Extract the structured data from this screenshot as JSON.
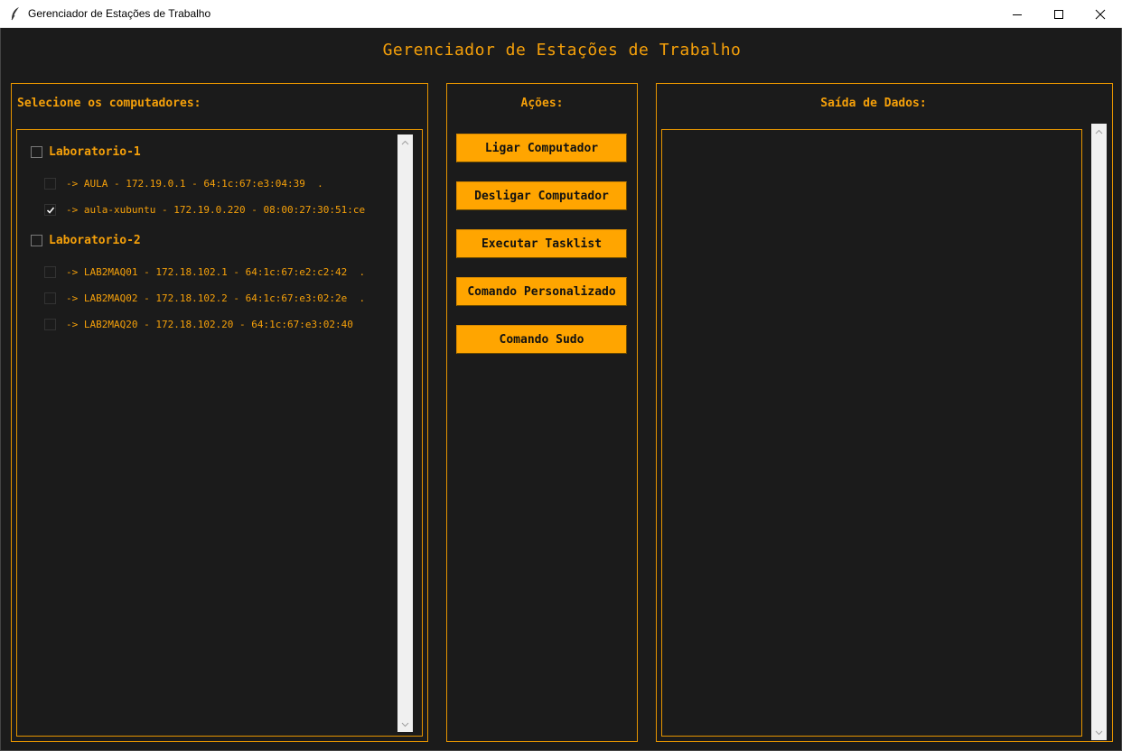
{
  "window": {
    "title": "Gerenciador de Estações de Trabalho",
    "icon": "feather-icon"
  },
  "app": {
    "heading": "Gerenciador de Estações de Trabalho",
    "accent_color": "#f5a00a",
    "background_color": "#1b1b1b"
  },
  "left_panel": {
    "label": "Selecione os computadores:",
    "groups": [
      {
        "label": "Laboratorio-1",
        "checked": false,
        "items": [
          {
            "label": "-> AULA - 172.19.0.1 - 64:1c:67:e3:04:39  .",
            "checked": false
          },
          {
            "label": "-> aula-xubuntu - 172.19.0.220 - 08:00:27:30:51:ce",
            "checked": true
          }
        ]
      },
      {
        "label": "Laboratorio-2",
        "checked": false,
        "items": [
          {
            "label": "-> LAB2MAQ01 - 172.18.102.1 - 64:1c:67:e2:c2:42  .",
            "checked": false
          },
          {
            "label": "-> LAB2MAQ02 - 172.18.102.2 - 64:1c:67:e3:02:2e  .",
            "checked": false
          },
          {
            "label": "-> LAB2MAQ20 - 172.18.102.20 - 64:1c:67:e3:02:40",
            "checked": false
          }
        ]
      }
    ]
  },
  "actions_panel": {
    "label": "Ações:",
    "buttons": [
      "Ligar Computador",
      "Desligar Computador",
      "Executar Tasklist",
      "Comando Personalizado",
      "Comando Sudo"
    ]
  },
  "output_panel": {
    "label": "Saída de Dados:",
    "content": ""
  }
}
